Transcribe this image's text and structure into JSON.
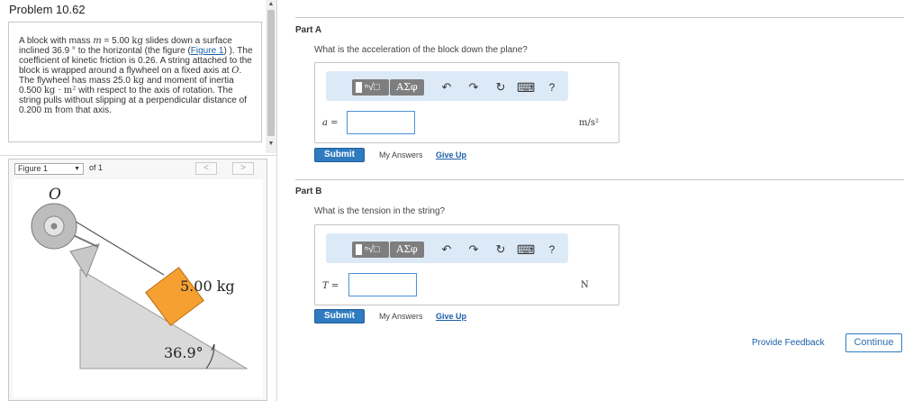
{
  "problem": {
    "title": "Problem 10.62",
    "text_1": "A block with mass ",
    "mass_var": "m",
    "text_2": " = 5.00 ",
    "kg": "kg",
    "text_3": " slides down a surface inclined 36.9 ° to the horizontal (the figure (",
    "figure_link": "Figure 1",
    "text_4": ") ). The coefficient of kinetic friction is 0.26. A string attached to the block is wrapped around a flywheel on a fixed axis at ",
    "axis_var": "O",
    "text_5": ". The flywheel has mass 25.0 ",
    "kg2": "kg",
    "text_6": " and moment of inertia 0.500 ",
    "inertia_unit": "kg · m²",
    "text_7": " with respect to the axis of rotation. The string pulls without slipping at a perpendicular distance of 0.200 ",
    "m_unit": "m",
    "text_8": " from that axis."
  },
  "figure": {
    "select_value": "Figure 1",
    "of_text": "of 1",
    "prev": "<",
    "next": ">",
    "label_o": "O",
    "mass_label": "5.00 kg",
    "angle_label": "36.9°"
  },
  "scroll": {
    "up": "▲",
    "down": "▼"
  },
  "toolbar": {
    "sqrt": "ⁿ√□",
    "greek": "ΑΣφ",
    "undo": "↶",
    "redo": "↷",
    "reset": "↻",
    "keyboard": "⌨",
    "help": "?"
  },
  "part_a": {
    "label": "Part A",
    "question": "What is the acceleration of the block down the plane?",
    "var": "a =",
    "value": "",
    "unit": "m/s²",
    "submit": "Submit",
    "my_answers": "My Answers",
    "give_up": "Give Up"
  },
  "part_b": {
    "label": "Part B",
    "question": "What is the tension in the string?",
    "var": "T =",
    "value": "",
    "unit": "N",
    "submit": "Submit",
    "my_answers": "My Answers",
    "give_up": "Give Up"
  },
  "footer": {
    "feedback": "Provide Feedback",
    "continue": "Continue"
  },
  "colors": {
    "accent": "#2f7bbf",
    "link": "#1a5fa8",
    "toolbar_bg": "#dce9f7",
    "block": "#f5a030",
    "incline": "#d9d9d9"
  }
}
